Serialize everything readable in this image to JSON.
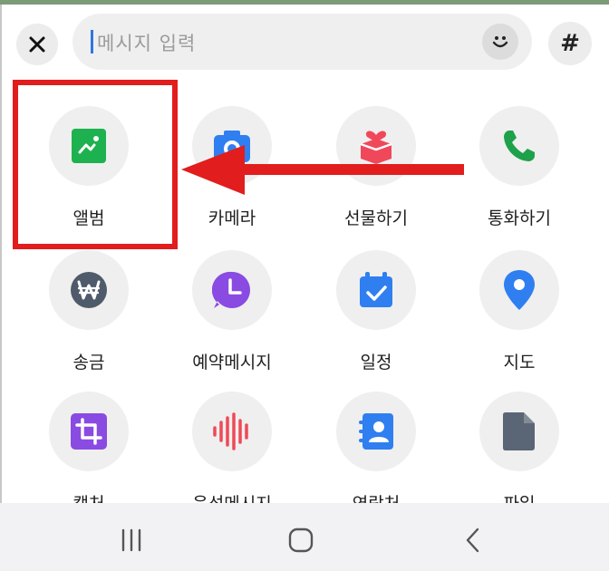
{
  "input": {
    "placeholder": "메시지 입력"
  },
  "hashtag": {
    "label": "#"
  },
  "menu": {
    "items": [
      {
        "label": "앨범",
        "icon": "album-icon",
        "color": "#1db24f"
      },
      {
        "label": "카메라",
        "icon": "camera-icon",
        "color": "#2f7ff0"
      },
      {
        "label": "선물하기",
        "icon": "gift-icon",
        "color": "#f0485a"
      },
      {
        "label": "통화하기",
        "icon": "phone-icon",
        "color": "#1ea14a"
      },
      {
        "label": "송금",
        "icon": "won-icon",
        "color": "#4f5a6a"
      },
      {
        "label": "예약메시지",
        "icon": "clock-icon",
        "color": "#8a4be2"
      },
      {
        "label": "일정",
        "icon": "calendar-icon",
        "color": "#2f7ff0"
      },
      {
        "label": "지도",
        "icon": "map-pin-icon",
        "color": "#2f7ff0"
      },
      {
        "label": "캡처",
        "icon": "crop-icon",
        "color": "#8a4be2"
      },
      {
        "label": "음성메시지",
        "icon": "voice-wave-icon",
        "color": "#ee4a57"
      },
      {
        "label": "연락처",
        "icon": "contact-icon",
        "color": "#2f7ff0"
      },
      {
        "label": "파일",
        "icon": "file-icon",
        "color": "#5a6575"
      }
    ]
  },
  "annotation": {
    "box_color": "#e21d1d",
    "arrow_color": "#e21d1d"
  },
  "navbar": {
    "buttons": [
      "recent-apps-icon",
      "home-icon",
      "back-icon"
    ]
  }
}
